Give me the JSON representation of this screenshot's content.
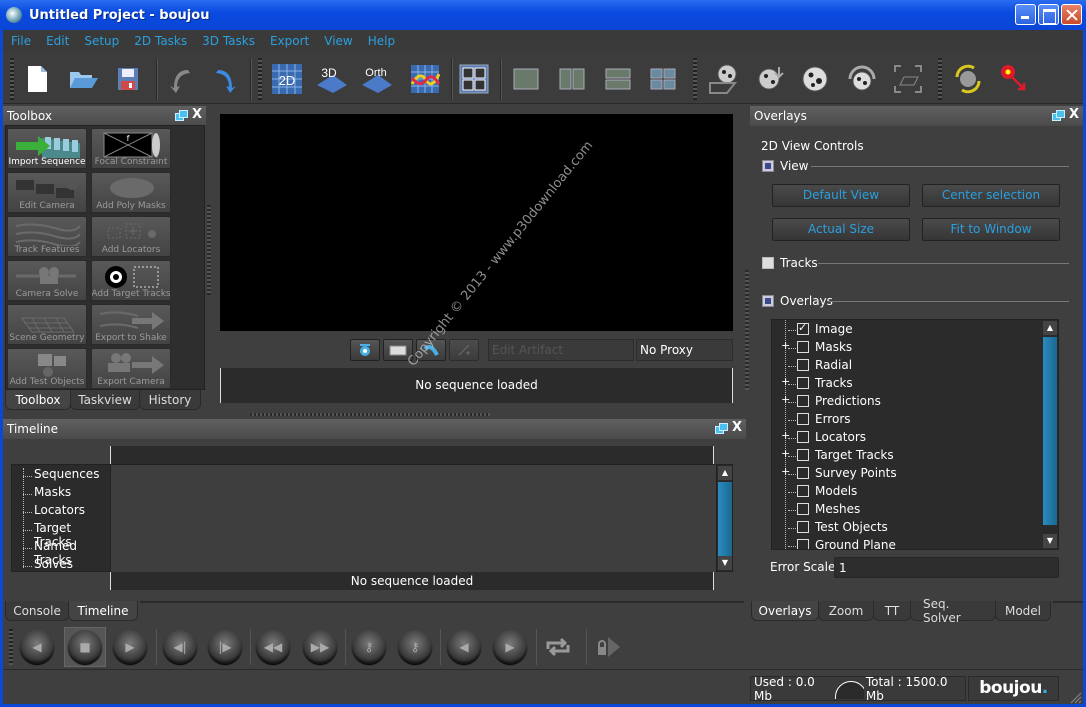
{
  "window": {
    "title": "Untitled Project - boujou",
    "controls": [
      "minimize",
      "maximize",
      "close"
    ]
  },
  "menu": [
    "File",
    "Edit",
    "Setup",
    "2D Tasks",
    "3D Tasks",
    "Export",
    "View",
    "Help"
  ],
  "toolbar": {
    "buttons": [
      {
        "name": "new-file",
        "icon": "new-file-icon"
      },
      {
        "name": "open-folder",
        "icon": "open-folder-icon"
      },
      {
        "name": "save",
        "icon": "save-icon"
      },
      {
        "name": "undo",
        "icon": "undo-icon"
      },
      {
        "name": "redo",
        "icon": "redo-icon"
      },
      {
        "name": "view-2d",
        "icon": "view-2d-icon",
        "label": "2D"
      },
      {
        "name": "view-3d",
        "icon": "view-3d-icon",
        "label": "3D"
      },
      {
        "name": "view-orth",
        "icon": "view-orth-icon",
        "label": "Orth"
      },
      {
        "name": "graph-view",
        "icon": "graph-icon"
      },
      {
        "name": "grid-layout",
        "icon": "grid-layout-icon"
      },
      {
        "name": "layout-single",
        "icon": "layout-single-icon"
      },
      {
        "name": "layout-two-vertical",
        "icon": "layout-two-vertical-icon"
      },
      {
        "name": "layout-two-horizontal",
        "icon": "layout-two-horizontal-icon"
      },
      {
        "name": "layout-four",
        "icon": "layout-four-icon"
      },
      {
        "name": "camera-ground",
        "icon": "camera-ground-icon"
      },
      {
        "name": "camera-move",
        "icon": "camera-move-icon"
      },
      {
        "name": "camera-look",
        "icon": "camera-look-icon"
      },
      {
        "name": "camera-orbit",
        "icon": "camera-orbit-icon"
      },
      {
        "name": "frame-ground",
        "icon": "frame-ground-icon"
      },
      {
        "name": "camera-refresh",
        "icon": "camera-refresh-icon"
      },
      {
        "name": "locator-pin",
        "icon": "locator-pin-icon"
      }
    ]
  },
  "toolbox": {
    "title": "Toolbox",
    "tools": [
      {
        "label": "Import Sequence",
        "active": true
      },
      {
        "label": "Focal Constraint",
        "active": false
      },
      {
        "label": "Edit Camera",
        "active": false
      },
      {
        "label": "Add Poly Masks",
        "active": false
      },
      {
        "label": "Track Features",
        "active": false
      },
      {
        "label": "Add Locators",
        "active": false
      },
      {
        "label": "Camera Solve",
        "active": false
      },
      {
        "label": "Add Target Tracks",
        "active": false
      },
      {
        "label": "Scene Geometry",
        "active": false
      },
      {
        "label": "Export to Shake",
        "active": false
      },
      {
        "label": "Add Test Objects",
        "active": false
      },
      {
        "label": "Export Camera",
        "active": false
      }
    ],
    "tabs": [
      {
        "label": "Toolbox",
        "active": true
      },
      {
        "label": "Taskview",
        "active": false
      },
      {
        "label": "History",
        "active": false
      }
    ]
  },
  "viewer": {
    "edit_artifact_placeholder": "Edit Artifact",
    "proxy_value": "No Proxy",
    "sequence_status": "No sequence loaded"
  },
  "timeline": {
    "title": "Timeline",
    "tree": [
      "Sequences",
      "Masks",
      "Locators",
      "Target Tracks",
      "Named Tracks",
      "Solves"
    ],
    "status": "No sequence loaded",
    "tabs": [
      {
        "label": "Console",
        "active": false
      },
      {
        "label": "Timeline",
        "active": true
      }
    ]
  },
  "overlays": {
    "title": "Overlays",
    "section_title": "2D View Controls",
    "view_label": "View",
    "view_checked": true,
    "buttons": {
      "default_view": "Default View",
      "center_selection": "Center selection",
      "actual_size": "Actual Size",
      "fit_to_window": "Fit to Window"
    },
    "tracks_label": "Tracks",
    "tracks_checked": false,
    "overlays_label": "Overlays",
    "overlays_checked": true,
    "items": [
      {
        "label": "Image",
        "checked": true,
        "expandable": false
      },
      {
        "label": "Masks",
        "checked": false,
        "expandable": true
      },
      {
        "label": "Radial",
        "checked": false,
        "expandable": false
      },
      {
        "label": "Tracks",
        "checked": false,
        "expandable": true
      },
      {
        "label": "Predictions",
        "checked": false,
        "expandable": true
      },
      {
        "label": "Errors",
        "checked": false,
        "expandable": false
      },
      {
        "label": "Locators",
        "checked": false,
        "expandable": true
      },
      {
        "label": "Target Tracks",
        "checked": false,
        "expandable": true
      },
      {
        "label": "Survey Points",
        "checked": false,
        "expandable": true
      },
      {
        "label": "Models",
        "checked": false,
        "expandable": false
      },
      {
        "label": "Meshes",
        "checked": false,
        "expandable": false
      },
      {
        "label": "Test Objects",
        "checked": false,
        "expandable": false
      },
      {
        "label": "Ground Plane",
        "checked": false,
        "expandable": false
      }
    ],
    "error_scale_label": "Error Scale",
    "error_scale_value": "1",
    "tabs": [
      {
        "label": "Overlays",
        "active": true
      },
      {
        "label": "Zoom",
        "active": false
      },
      {
        "label": "TT",
        "active": false
      },
      {
        "label": "Seq. Solver",
        "active": false
      },
      {
        "label": "Model",
        "active": false
      }
    ]
  },
  "playback": {
    "buttons": [
      "play-backward",
      "stop",
      "play-forward",
      "step-back",
      "step-forward",
      "jump-start",
      "jump-end",
      "prev-key",
      "next-key",
      "prev-marker",
      "next-marker",
      "loop",
      "lock-forward"
    ]
  },
  "status": {
    "used": "Used : 0.0 Mb",
    "total": "Total : 1500.0 Mb",
    "logo": "boujou",
    "logo_dot": "."
  },
  "watermark": "Copyright © 2013 - www.p30download.com",
  "colors": {
    "accent": "#2aa0e0",
    "titlebar": "#0a4be0",
    "background": "#3f3f3f"
  }
}
